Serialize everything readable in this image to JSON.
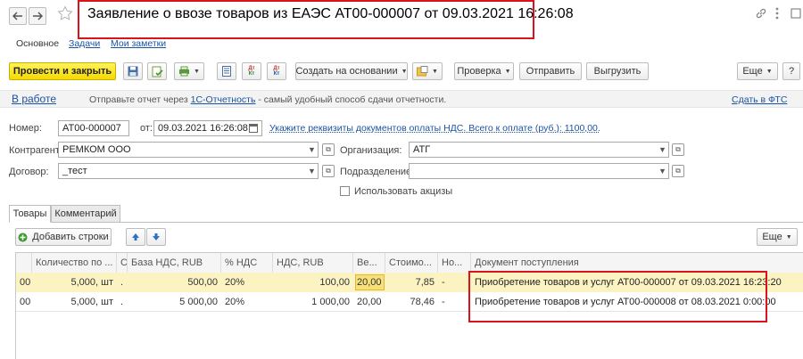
{
  "window": {
    "title": "Заявление о ввозе товаров из ЕАЭС АТ00-000007 от 09.03.2021 16:26:08",
    "back_icon": "back-arrow-icon",
    "forward_icon": "forward-arrow-icon",
    "star_icon": "star-icon",
    "link_icon": "link-icon",
    "more_icon": "vertical-dots-icon",
    "maximize_icon": "maximize-icon",
    "close_icon": "close-icon"
  },
  "subtabs": [
    "Основное",
    "Задачи",
    "Мои заметки"
  ],
  "toolbar": {
    "post_close": "Провести и закрыть",
    "create_based": "Создать на основании",
    "check": "Проверка",
    "send": "Отправить",
    "upload": "Выгрузить",
    "more": "Еще",
    "help": "?",
    "dt_label": "Дт",
    "kt_label": "Кт"
  },
  "status": {
    "state": "В работе",
    "text_before": "Отправьте отчет через",
    "link": "1С-Отчетность",
    "text_after": "- самый удобный способ сдачи отчетности.",
    "submit_fts": "Сдать в ФТС"
  },
  "form": {
    "number_label": "Номер:",
    "number_value": "АТ00-000007",
    "from_label": "от:",
    "date_value": "09.03.2021 16:26:08",
    "vat_link": "Укажите реквизиты документов оплаты НДС. Всего к оплате (руб.): 1100,00.",
    "counterparty_label": "Контрагент:",
    "counterparty_value": "РЕМКОМ ООО",
    "organization_label": "Организация:",
    "organization_value": "АТГ",
    "contract_label": "Договор:",
    "contract_value": "_тест",
    "division_label": "Подразделение:",
    "division_value": "",
    "excise_label": "Использовать акцизы",
    "excise_checked": false
  },
  "tabs": [
    "Товары",
    "Комментарий"
  ],
  "table_toolbar": {
    "add_rows": "Добавить строки",
    "more": "Еще"
  },
  "table": {
    "headers": [
      "",
      "Количество по ...",
      "С",
      "База НДС, RUB",
      "% НДС",
      "НДС, RUB",
      "Ве...",
      "Стоимо...",
      "Но...",
      "Документ поступления"
    ],
    "rows": [
      [
        "00",
        "5,000, шт",
        ".",
        "500,00",
        "20%",
        "100,00",
        "20,00",
        "7,85",
        "-",
        "Приобретение товаров и услуг АТ00-000007 от 09.03.2021 16:23:20"
      ],
      [
        "00",
        "5,000, шт",
        ".",
        "5 000,00",
        "20%",
        "1 000,00",
        "20,00",
        "78,46",
        "-",
        "Приобретение товаров и услуг АТ00-000008 от 08.03.2021 0:00:00"
      ]
    ]
  },
  "colors": {
    "primary_button": "#f7d900",
    "link": "#1c53a3",
    "highlight": "#d9141c",
    "selected_row": "#fbf3c1",
    "active_cell": "#f5e07a"
  }
}
